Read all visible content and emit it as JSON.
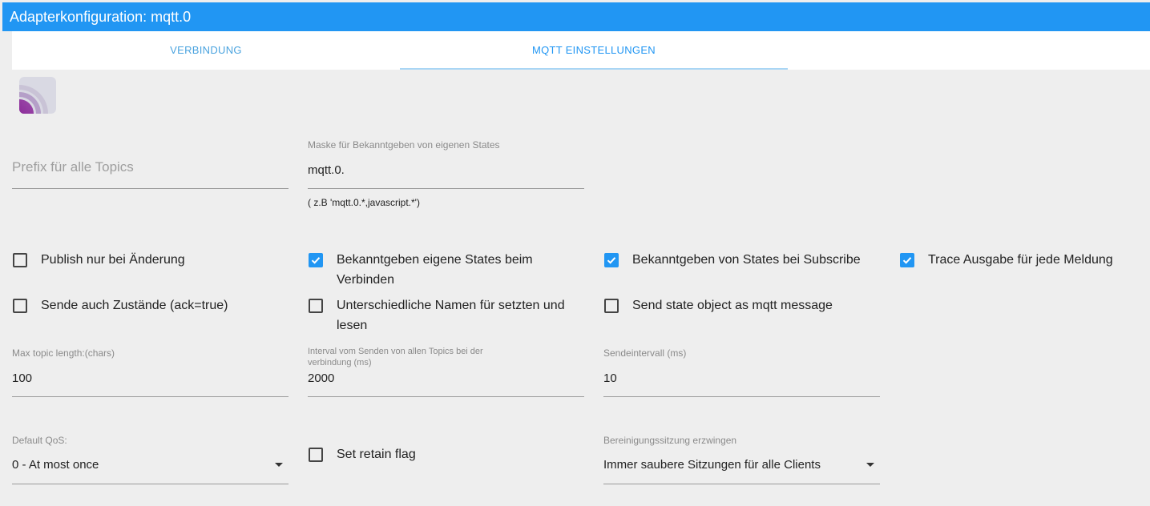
{
  "title": "Adapterkonfiguration: mqtt.0",
  "tabs": [
    {
      "label": "VERBINDUNG"
    },
    {
      "label": "MQTT EINSTELLUNGEN"
    }
  ],
  "logo_icon": "mqtt-logo-icon",
  "fields": {
    "prefix": {
      "placeholder": "Prefix für alle Topics"
    },
    "mask": {
      "label": "Maske für Bekanntgeben von eigenen States",
      "value": "mqtt.0.",
      "helper": "( z.B 'mqtt.0.*,javascript.*')"
    },
    "max_topic": {
      "label": "Max topic length:(chars)",
      "value": "100"
    },
    "interval_all": {
      "label": "Interval vom Senden von allen Topics bei der verbindung (ms)",
      "value": "2000"
    },
    "send_interval": {
      "label": "Sendeintervall (ms)",
      "value": "10"
    },
    "default_qos": {
      "label": "Default QoS:",
      "value": "0 - At most once"
    },
    "clean_session": {
      "label": "Bereinigungssitzung erzwingen",
      "value": "Immer saubere Sitzungen für alle Clients"
    }
  },
  "checkboxes": {
    "publish_on_change": {
      "label": "Publish nur bei Änderung",
      "checked": false
    },
    "publish_own_states": {
      "label": "Bekanntgeben eigene States beim Verbinden",
      "checked": true
    },
    "publish_on_subscribe": {
      "label": "Bekanntgeben von States bei Subscribe",
      "checked": true
    },
    "trace_output": {
      "label": "Trace Ausgabe für jede Meldung",
      "checked": true
    },
    "send_ack_true": {
      "label": "Sende auch Zustände (ack=true)",
      "checked": false
    },
    "different_names": {
      "label": "Unterschiedliche Namen für setzten und lesen",
      "checked": false
    },
    "state_object": {
      "label": "Send state object as mqtt message",
      "checked": false
    },
    "retain_flag": {
      "label": "Set retain flag",
      "checked": false
    }
  },
  "colors": {
    "accent": "#2196f3",
    "background": "#eeeeee"
  }
}
